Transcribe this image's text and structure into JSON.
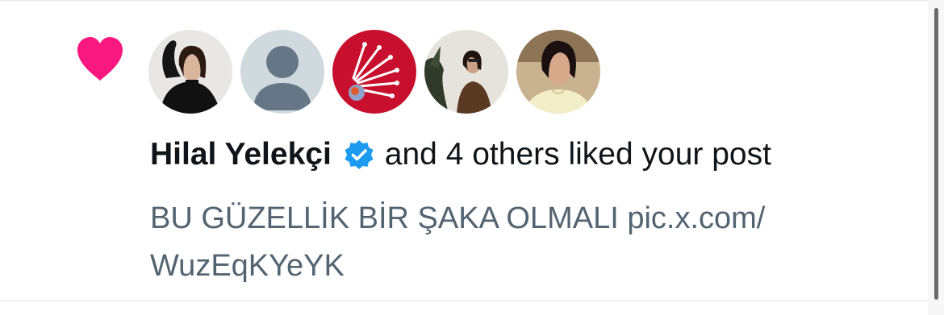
{
  "notification": {
    "type_icon": "heart-icon",
    "heart_color": "#f91880",
    "avatars": [
      {
        "icon": "avatar-woman-black-outfit"
      },
      {
        "icon": "default-avatar-icon"
      },
      {
        "icon": "avatar-red-badge"
      },
      {
        "icon": "avatar-woman-plants"
      },
      {
        "icon": "avatar-woman-portrait"
      }
    ],
    "user_name": "Hilal Yelekçi",
    "verified_icon": "verified-badge-icon",
    "verified_color": "#1d9bf0",
    "action_text": "and 4 others liked your post",
    "post_text": "BU GÜZELLİK BİR ŞAKA OLMALI pic.x.com/\nWuzEqKYeYK"
  }
}
